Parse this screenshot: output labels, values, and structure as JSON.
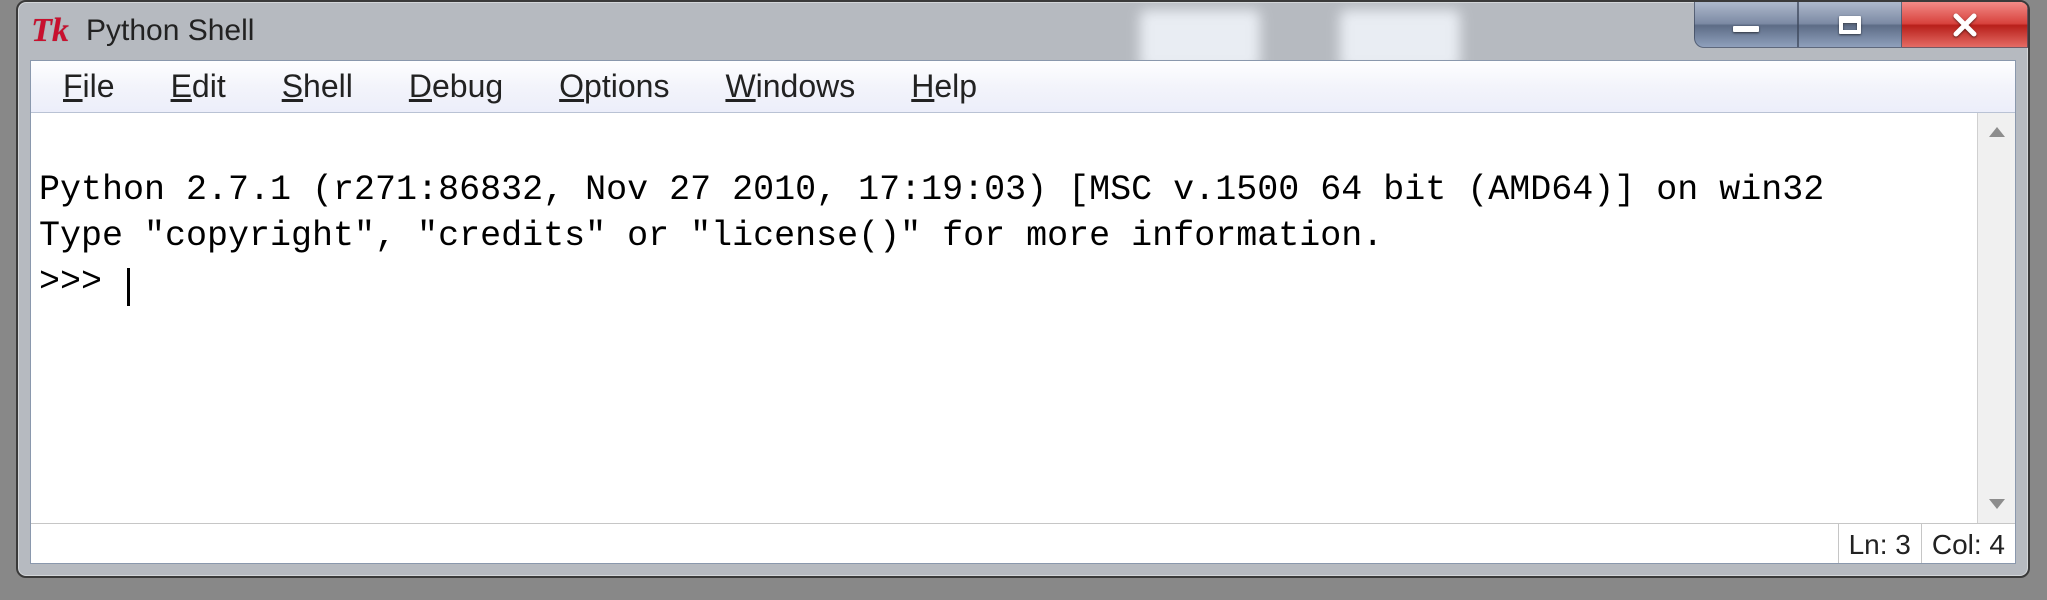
{
  "window": {
    "title": "Python Shell",
    "icon_label": "Tk"
  },
  "menu": {
    "file": {
      "label": "File",
      "hotkey_index": 0
    },
    "edit": {
      "label": "Edit",
      "hotkey_index": 0
    },
    "shell": {
      "label": "Shell",
      "hotkey_index": 0
    },
    "debug": {
      "label": "Debug",
      "hotkey_index": 0
    },
    "options": {
      "label": "Options",
      "hotkey_index": 0
    },
    "windows": {
      "label": "Windows",
      "hotkey_index": 0
    },
    "help": {
      "label": "Help",
      "hotkey_index": 0
    }
  },
  "shell": {
    "banner_line1": "Python 2.7.1 (r271:86832, Nov 27 2010, 17:19:03) [MSC v.1500 64 bit (AMD64)] on win32",
    "banner_line2": "Type \"copyright\", \"credits\" or \"license()\" for more information.",
    "prompt": ">>> "
  },
  "status": {
    "line_label": "Ln: 3",
    "col_label": "Col: 4"
  },
  "caption": {
    "minimize": "minimize",
    "maximize": "maximize",
    "close": "close"
  }
}
